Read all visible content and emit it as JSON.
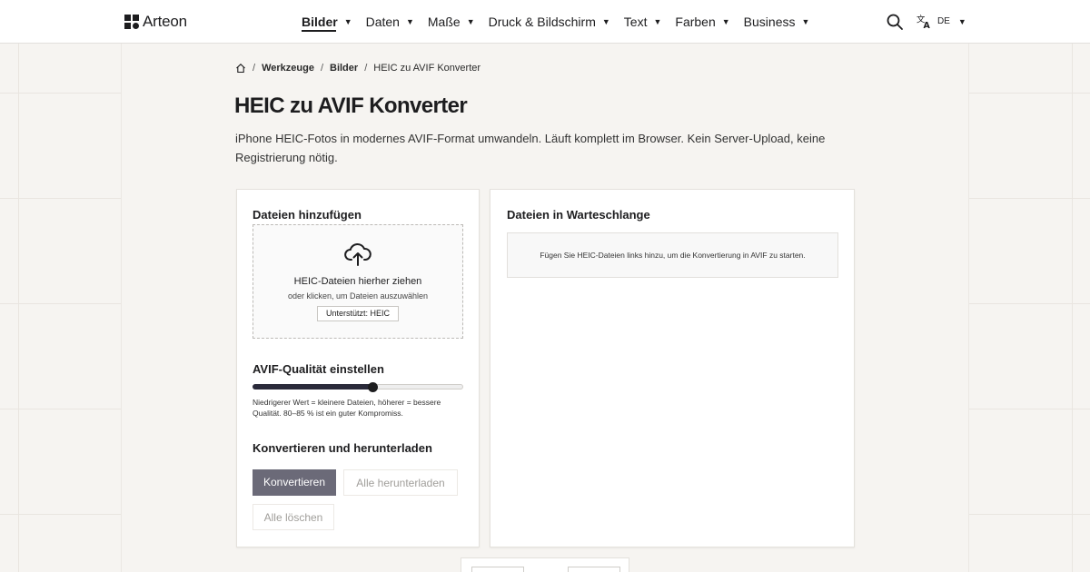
{
  "brand": {
    "name": "Arteon"
  },
  "nav": {
    "items": [
      {
        "label": "Bilder",
        "active": true
      },
      {
        "label": "Daten"
      },
      {
        "label": "Maße"
      },
      {
        "label": "Druck & Bildschirm"
      },
      {
        "label": "Text"
      },
      {
        "label": "Farben"
      },
      {
        "label": "Business"
      }
    ],
    "search_icon": "search-icon",
    "language": {
      "code": "DE",
      "icon": "translate-icon"
    }
  },
  "breadcrumb": {
    "home_icon": "home-icon",
    "items": [
      "Werkzeuge",
      "Bilder"
    ],
    "current": "HEIC zu AVIF Konverter"
  },
  "page": {
    "title": "HEIC zu AVIF Konverter",
    "description": "iPhone HEIC-Fotos in modernes AVIF-Format umwandeln. Läuft komplett im Browser. Kein Server-Upload, keine Registrierung nötig."
  },
  "add_files": {
    "title": "Dateien hinzufügen",
    "dropzone": {
      "icon": "cloud-upload-icon",
      "title": "HEIC-Dateien hierher ziehen",
      "subtitle": "oder klicken, um Dateien auszuwählen",
      "badge": "Unterstützt: HEIC"
    }
  },
  "quality": {
    "title": "AVIF-Qualität einstellen",
    "value_fraction": 0.57,
    "hint": "Niedrigerer Wert = kleinere Dateien, höherer = bessere Qualität. 80–85 % ist ein guter Kompromiss."
  },
  "convert": {
    "title": "Konvertieren und herunterladen",
    "convert_label": "Konvertieren",
    "download_all_label": "Alle herunterladen",
    "clear_all_label": "Alle löschen"
  },
  "queue": {
    "title": "Dateien in Warteschlange",
    "empty_message": "Fügen Sie HEIC-Dateien links hinzu, um die Konvertierung in AVIF zu starten."
  },
  "colors": {
    "primary_button": "#6b6a78",
    "slider_fill": "#2a2a3a",
    "background": "#f6f4f1"
  }
}
